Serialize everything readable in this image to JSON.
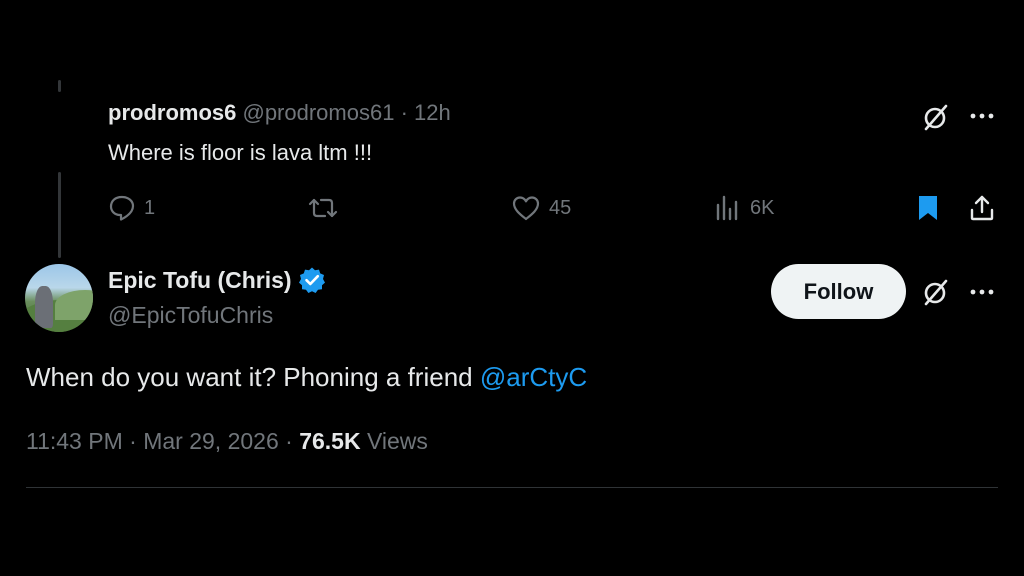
{
  "reply": {
    "name": "prodromos6",
    "handle": "@prodromos61",
    "separator": "·",
    "time": "12h",
    "text": "Where is floor is lava ltm !!!",
    "actions": {
      "replies": "1",
      "reposts": "",
      "likes": "45",
      "views": "6K"
    },
    "bookmarked": true
  },
  "tweet": {
    "author_name": "Epic Tofu (Chris)",
    "author_handle": "@EpicTofuChris",
    "verified": true,
    "follow_label": "Follow",
    "text_prefix": "When do you want it? Phoning a friend ",
    "mention": "@arCtyC",
    "time": "11:43 PM",
    "date": "Mar 29, 2026",
    "separator": "·",
    "views_count": "76.5K",
    "views_label": "Views"
  },
  "icons": {
    "grok": "grok-icon",
    "more": "more-icon",
    "reply": "reply-icon",
    "repost": "repost-icon",
    "like": "heart-icon",
    "views": "views-icon",
    "bookmark": "bookmark-icon",
    "share": "share-icon",
    "verified": "verified-badge-icon"
  },
  "colors": {
    "background": "#000000",
    "text": "#e7e9ea",
    "muted": "#71767b",
    "accent": "#1d9bf0",
    "follow_bg": "#eff3f4"
  }
}
